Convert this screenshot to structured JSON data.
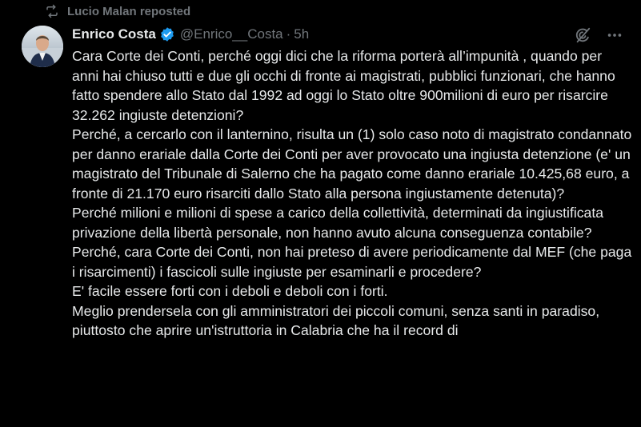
{
  "colors": {
    "background": "#000000",
    "text_primary": "#e7e9ea",
    "text_secondary": "#71767b",
    "verified_badge": "#1d9bf0"
  },
  "repost": {
    "icon": "repost-icon",
    "label": "Lucio Malan reposted"
  },
  "author": {
    "display_name": "Enrico Costa",
    "verified_icon": "verified-badge-icon",
    "handle": "@Enrico__Costa",
    "separator": "·",
    "time": "5h"
  },
  "actions": {
    "grok_icon": "grok-icon",
    "more_icon": "more-icon"
  },
  "tweet": {
    "paragraphs": [
      "Cara Corte dei Conti, perché oggi dici che la riforma porterà all’impunità , quando per anni hai chiuso tutti e due gli occhi di fronte ai magistrati, pubblici funzionari, che hanno fatto spendere allo Stato dal 1992 ad oggi lo Stato oltre 900milioni di euro per risarcire 32.262 ingiuste detenzioni?",
      "Perché, a cercarlo con il lanternino, risulta un (1) solo caso noto di magistrato condannato per danno erariale dalla Corte dei Conti per aver provocato una ingiusta detenzione (e' un magistrato del Tribunale di Salerno che ha pagato come danno erariale 10.425,68 euro, a fronte di 21.170 euro risarciti dallo Stato alla persona ingiustamente detenuta)?",
      "Perché milioni e milioni di spese a carico della collettività, determinati da ingiustificata privazione della libertà personale, non hanno avuto alcuna conseguenza contabile?",
      "Perché, cara Corte dei Conti, non hai preteso di avere periodicamente dal MEF (che paga i risarcimenti) i fascicoli sulle ingiuste per esaminarli e procedere?",
      "E' facile essere forti con i deboli e deboli con i forti.",
      "Meglio prendersela con gli amministratori dei piccoli comuni, senza santi in paradiso, piuttosto che aprire un'istruttoria in Calabria che ha il record di"
    ]
  }
}
